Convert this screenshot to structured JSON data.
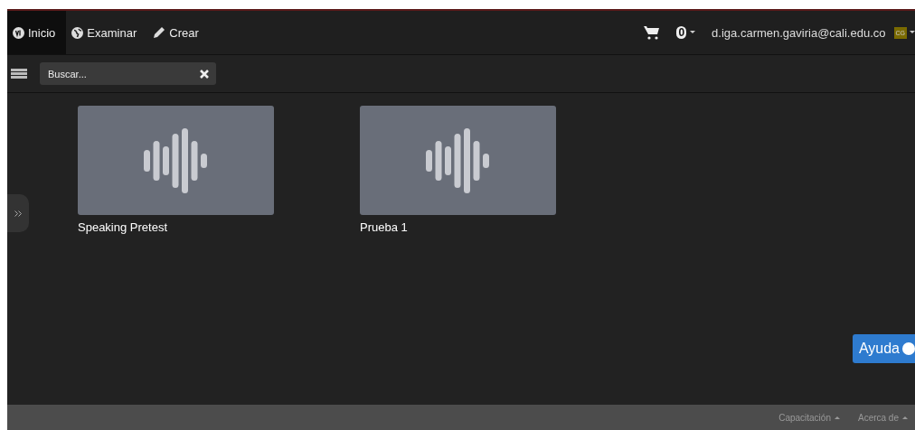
{
  "nav": {
    "tabs": [
      {
        "label": "Inicio",
        "kind": "logo",
        "selected": true
      },
      {
        "label": "Examinar",
        "kind": "globe",
        "selected": false
      },
      {
        "label": "Crear",
        "kind": "pencil",
        "selected": false
      }
    ],
    "cart_count": "0",
    "user_email": "d.iga.carmen.gaviria@cali.edu.co",
    "avatar": "CG"
  },
  "search": {
    "placeholder": "Buscar..."
  },
  "cards": [
    {
      "title": "Speaking Pretest",
      "kind": "audio"
    },
    {
      "title": "Prueba 1",
      "kind": "audio"
    }
  ],
  "help_button": "Ayuda",
  "footer": {
    "links": [
      "Capacitación",
      "Acerca de"
    ]
  }
}
